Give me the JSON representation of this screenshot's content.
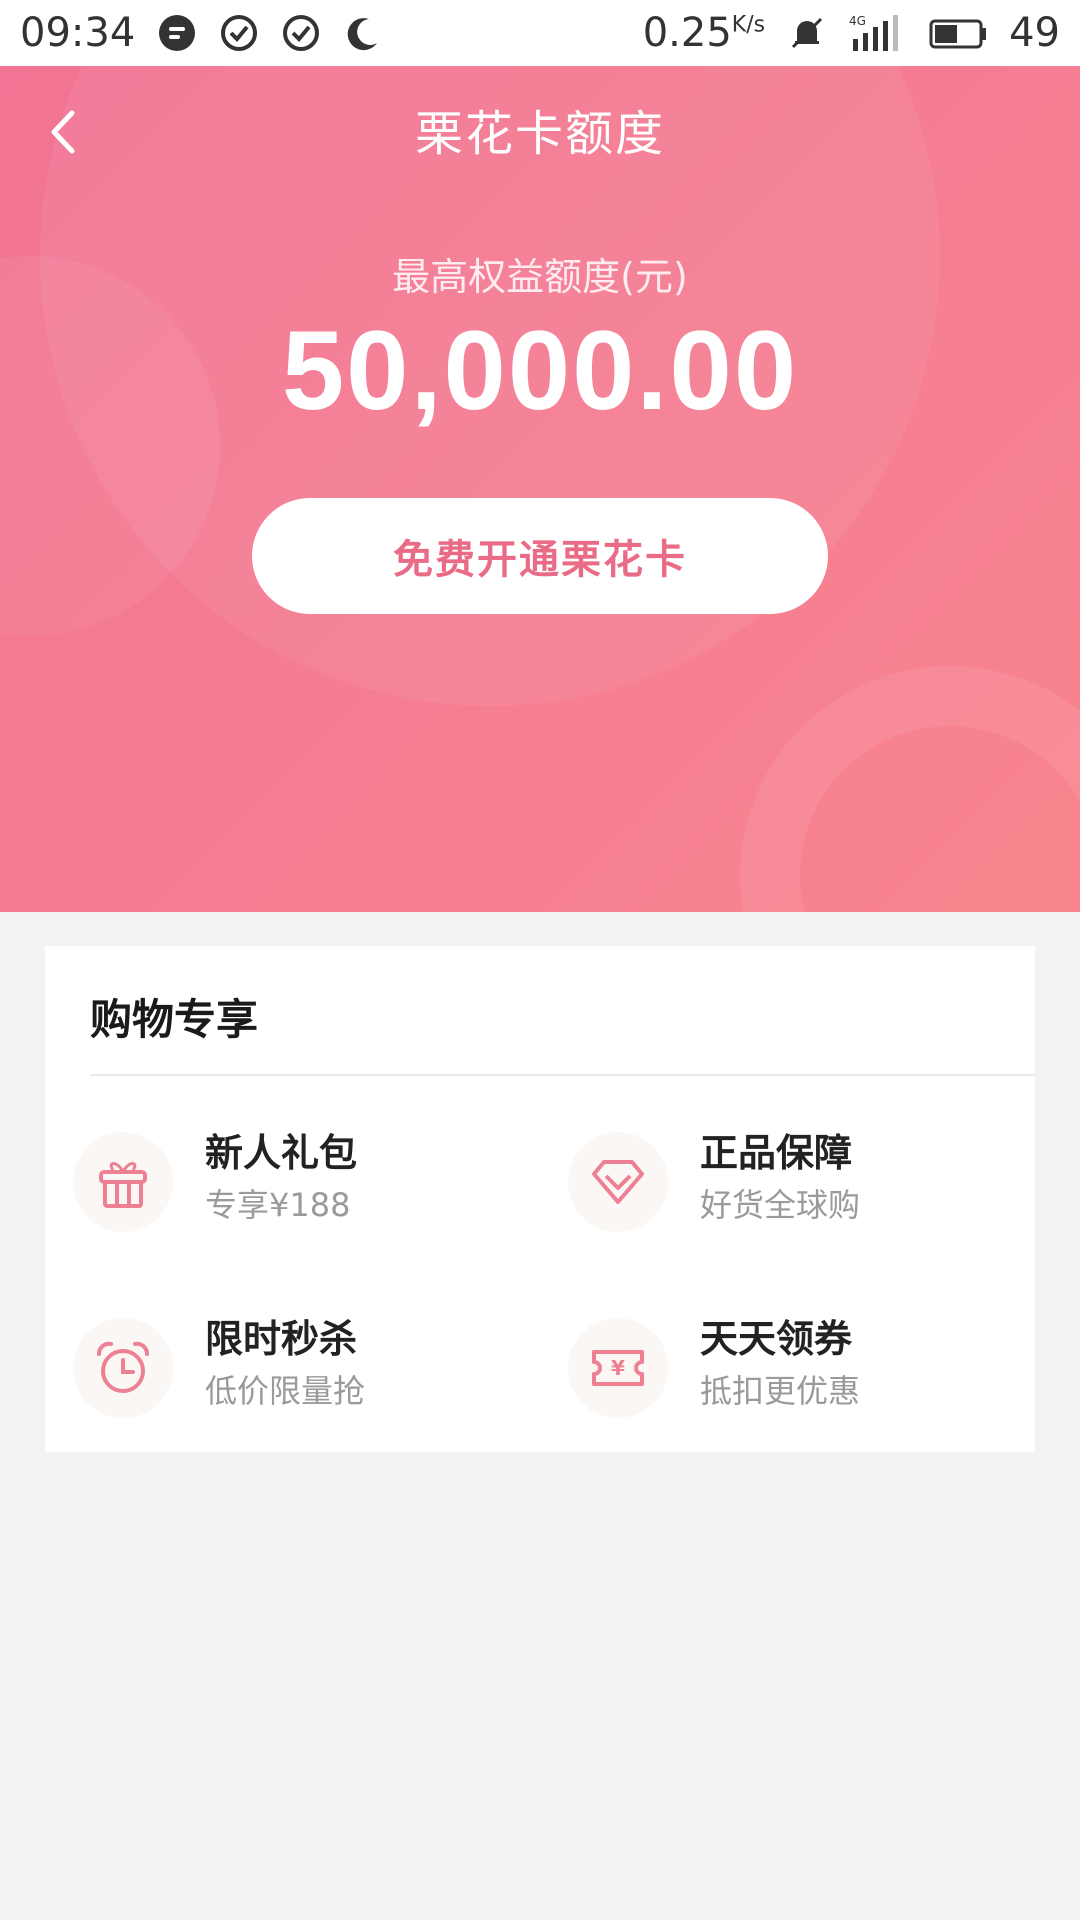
{
  "status_bar": {
    "time": "09:34",
    "speed_value": "0.25",
    "speed_unit": "K/s",
    "network": "4G",
    "battery": "49"
  },
  "header": {
    "title": "栗花卡额度",
    "subtitle": "最高权益额度(元)",
    "amount": "50,000.00",
    "cta_label": "免费开通栗花卡"
  },
  "shopping": {
    "title": "购物专享",
    "items": [
      {
        "name": "新人礼包",
        "desc": "专享¥188",
        "icon": "gift-icon"
      },
      {
        "name": "正品保障",
        "desc": "好货全球购",
        "icon": "diamond-icon"
      },
      {
        "name": "限时秒杀",
        "desc": "低价限量抢",
        "icon": "alarm-clock-icon"
      },
      {
        "name": "天天领券",
        "desc": "抵扣更优惠",
        "icon": "coupon-icon"
      }
    ]
  },
  "colors": {
    "brand_pink": "#f27393",
    "cta_text": "#ea6b86",
    "icon_pink": "#ee8094"
  }
}
